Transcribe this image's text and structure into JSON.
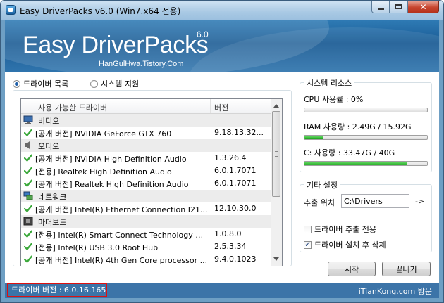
{
  "window": {
    "title": "Easy DriverPacks v6.0  (Win7.x64 전용)",
    "close_glyph": "✕"
  },
  "banner": {
    "brand": "Easy DriverPacks",
    "version": "6.0",
    "subtitle": "HanGulHwa.Tistory.Com"
  },
  "tabs": {
    "driver_list": "드라이버 목록",
    "system_support": "시스템 지원",
    "selected": "driver_list"
  },
  "driver_list": {
    "columns": [
      "사용 가능한 드라이버",
      "버전"
    ],
    "rows": [
      {
        "type": "group",
        "icon": "video-category-icon",
        "name": "비디오"
      },
      {
        "type": "item",
        "name": "[공개 버전] NVIDIA GeForce GTX 760",
        "version": "9.18.13.32..."
      },
      {
        "type": "group",
        "icon": "audio-category-icon",
        "name": "오디오"
      },
      {
        "type": "item",
        "name": "[공개 버전] NVIDIA High Definition Audio",
        "version": "1.3.26.4"
      },
      {
        "type": "item",
        "name": "[전용] Realtek High Definition Audio",
        "version": "6.0.1.7071"
      },
      {
        "type": "item",
        "name": "[공개 버전] Realtek High Definition Audio",
        "version": "6.0.1.7071"
      },
      {
        "type": "group",
        "icon": "network-category-icon",
        "name": "네트워크"
      },
      {
        "type": "item",
        "name": "[공개 버전] Intel(R) Ethernet Connection I21...",
        "version": "12.10.30.0"
      },
      {
        "type": "group",
        "icon": "motherboard-category-icon",
        "name": "마더보드"
      },
      {
        "type": "item",
        "name": "[전용] Intel(R) Smart Connect Technology D...",
        "version": "1.0.8.0"
      },
      {
        "type": "item",
        "name": "[전용] Intel(R) USB 3.0 Root Hub",
        "version": "2.5.3.34"
      },
      {
        "type": "item",
        "name": "[공개 버전] Intel(R) 4th Gen Core processor ...",
        "version": "9.4.0.1023"
      }
    ]
  },
  "system_resources": {
    "title": "시스템 리소스",
    "cpu": {
      "label": "CPU 사용률 :  0%",
      "fraction": 0.0
    },
    "ram": {
      "label": "RAM 사용량 : 2.49G / 15.92G",
      "fraction": 0.156
    },
    "disk": {
      "label": "C:   사용량 :  33.47G / 40G",
      "fraction": 0.837
    }
  },
  "other_settings": {
    "title": "기타 설정",
    "extract_location_label": "추출 위치",
    "extract_path": "C:\\Drivers",
    "arrow": "->",
    "options": [
      {
        "label": "드라이버 추출 전용",
        "checked": false
      },
      {
        "label": "드라이버 설치 후 삭제",
        "checked": true
      }
    ]
  },
  "buttons": {
    "start": "시작",
    "close": "끝내기"
  },
  "status": {
    "driver_version": "드라이버 버전 : 6.0.16.165",
    "site": "iTianKong.com 방문"
  },
  "colors": {
    "banner": "#1a5b94",
    "statusbar": "#3c74a8",
    "progress_fill": "#1ea51e",
    "highlight_border": "#dd1111"
  }
}
